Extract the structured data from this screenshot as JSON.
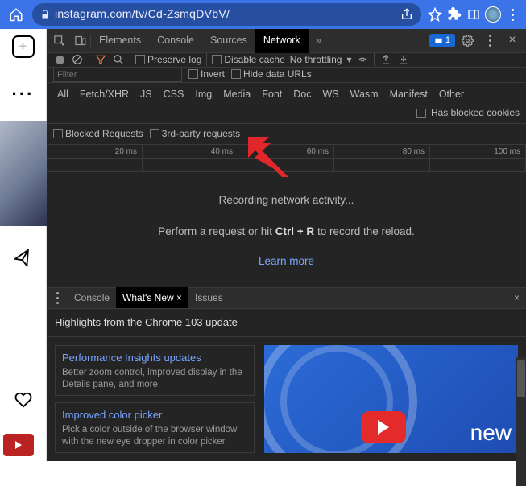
{
  "url": "instagram.com/tv/Cd-ZsmqDVbV/",
  "chat_badge": "1",
  "devtools_tabs": {
    "elements": "Elements",
    "console": "Console",
    "sources": "Sources",
    "network": "Network"
  },
  "toolbar": {
    "preserve_log": "Preserve log",
    "disable_cache": "Disable cache",
    "throttling": "No throttling"
  },
  "filter": {
    "placeholder": "Filter",
    "invert": "Invert",
    "hide_data_urls": "Hide data URLs"
  },
  "type_filters": {
    "all": "All",
    "fetch": "Fetch/XHR",
    "js": "JS",
    "css": "CSS",
    "img": "Img",
    "media": "Media",
    "font": "Font",
    "doc": "Doc",
    "ws": "WS",
    "wasm": "Wasm",
    "manifest": "Manifest",
    "other": "Other",
    "has_blocked_cookies": "Has blocked cookies",
    "blocked_requests": "Blocked Requests",
    "third_party": "3rd-party requests"
  },
  "timeline": {
    "t1": "20 ms",
    "t2": "40 ms",
    "t3": "60 ms",
    "t4": "80 ms",
    "t5": "100 ms"
  },
  "recording": {
    "line1": "Recording network activity...",
    "line2_pre": "Perform a request or hit ",
    "shortcut": "Ctrl + R",
    "line2_post": " to record the reload.",
    "learn_more": "Learn more"
  },
  "drawer": {
    "console": "Console",
    "whats_new": "What's New",
    "issues": "Issues",
    "heading": "Highlights from the Chrome 103 update",
    "card1_title": "Performance Insights updates",
    "card1_desc": "Better zoom control, improved display in the Details pane, and more.",
    "card2_title": "Improved color picker",
    "card2_desc": "Pick a color outside of the browser window with the new eye dropper in color picker.",
    "video_text": "new"
  }
}
